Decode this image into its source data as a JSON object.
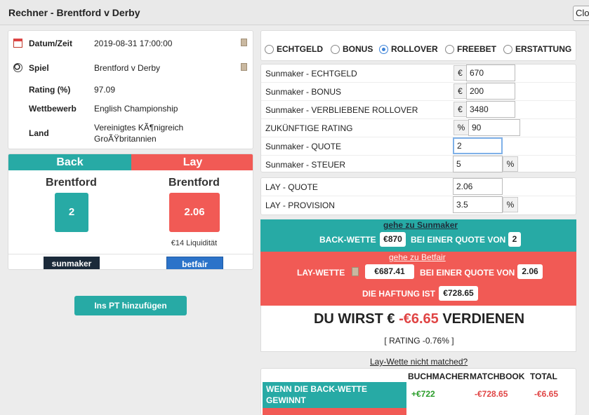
{
  "window": {
    "title": "Rechner - Brentford v Derby",
    "close_label": "Clo"
  },
  "info": {
    "rows": [
      {
        "icon": "calendar-icon",
        "label": "Datum/Zeit",
        "value": "2019-08-31 17:00:00"
      },
      {
        "icon": "soccer-ball-icon",
        "label": "Spiel",
        "value": "Brentford v Derby"
      },
      {
        "label": "Rating (%)",
        "value": "97.09"
      },
      {
        "label": "Wettbewerb",
        "value": "English Championship"
      },
      {
        "label": "Land",
        "value_line1": "Vereinigtes KÃ¶nigreich",
        "value_line2": "GroÃŸbritannien"
      }
    ]
  },
  "back": {
    "header": "Back",
    "team": "Brentford",
    "odds": "2",
    "bookmaker_logo": "sunmaker"
  },
  "lay": {
    "header": "Lay",
    "team": "Brentford",
    "odds": "2.06",
    "liquidity": "€14 Liquidität",
    "exchange_logo": "betfair"
  },
  "add_pt_button": "Ins PT hinzufügen",
  "modes": {
    "selected": "ROLLOVER",
    "options": [
      "ECHTGELD",
      "BONUS",
      "ROLLOVER",
      "FREEBET",
      "ERSTATTUNG"
    ]
  },
  "form": {
    "echtgeld": {
      "label": "Sunmaker - ECHTGELD",
      "prefix": "€",
      "value": "670"
    },
    "bonus": {
      "label": "Sunmaker - BONUS",
      "prefix": "€",
      "value": "200"
    },
    "rollover": {
      "label": "Sunmaker - VERBLIEBENE ROLLOVER",
      "prefix": "€",
      "value": "3480"
    },
    "future_rating": {
      "label": "ZUKÜNFTIGE RATING",
      "prefix": "%",
      "value": "90"
    },
    "quote": {
      "label": "Sunmaker - QUOTE",
      "value": "2"
    },
    "steuer": {
      "label": "Sunmaker - STEUER",
      "value": "5",
      "suffix": "%"
    },
    "lay_quote": {
      "label": "LAY - QUOTE",
      "value": "2.06"
    },
    "lay_provision": {
      "label": "LAY - PROVISION",
      "value": "3.5",
      "suffix": "%"
    }
  },
  "result": {
    "goto_bookmaker": "gehe zu Sunmaker",
    "back_bet_label": "BACK-WETTE",
    "back_stake": "€870",
    "at_odds_label": "BEI EINER QUOTE VON",
    "back_odds": "2",
    "goto_exchange": "gehe zu Betfair",
    "lay_bet_label": "LAY-WETTE",
    "lay_stake": "€687.41",
    "lay_odds": "2.06",
    "liability_label": "DIE HAFTUNG IST",
    "liability": "€728.65",
    "earn_prefix": "DU WIRST €",
    "earn_amount": "-€6.65",
    "earn_suffix": "VERDIENEN",
    "rating": "[ RATING -0.76% ]"
  },
  "not_matched_link": "Lay-Wette nicht matched?",
  "table": {
    "headers": [
      "BUCHMACHER",
      "MATCHBOOK",
      "TOTAL"
    ],
    "row_win": {
      "label": "WENN DIE BACK-WETTE GEWINNT",
      "bookmaker": "+€722",
      "exchange": "-€728.65",
      "total": "-€6.65"
    }
  },
  "colors": {
    "teal": "#27aaa5",
    "red": "#f15a55",
    "selected_radio": "#3d83d8"
  }
}
